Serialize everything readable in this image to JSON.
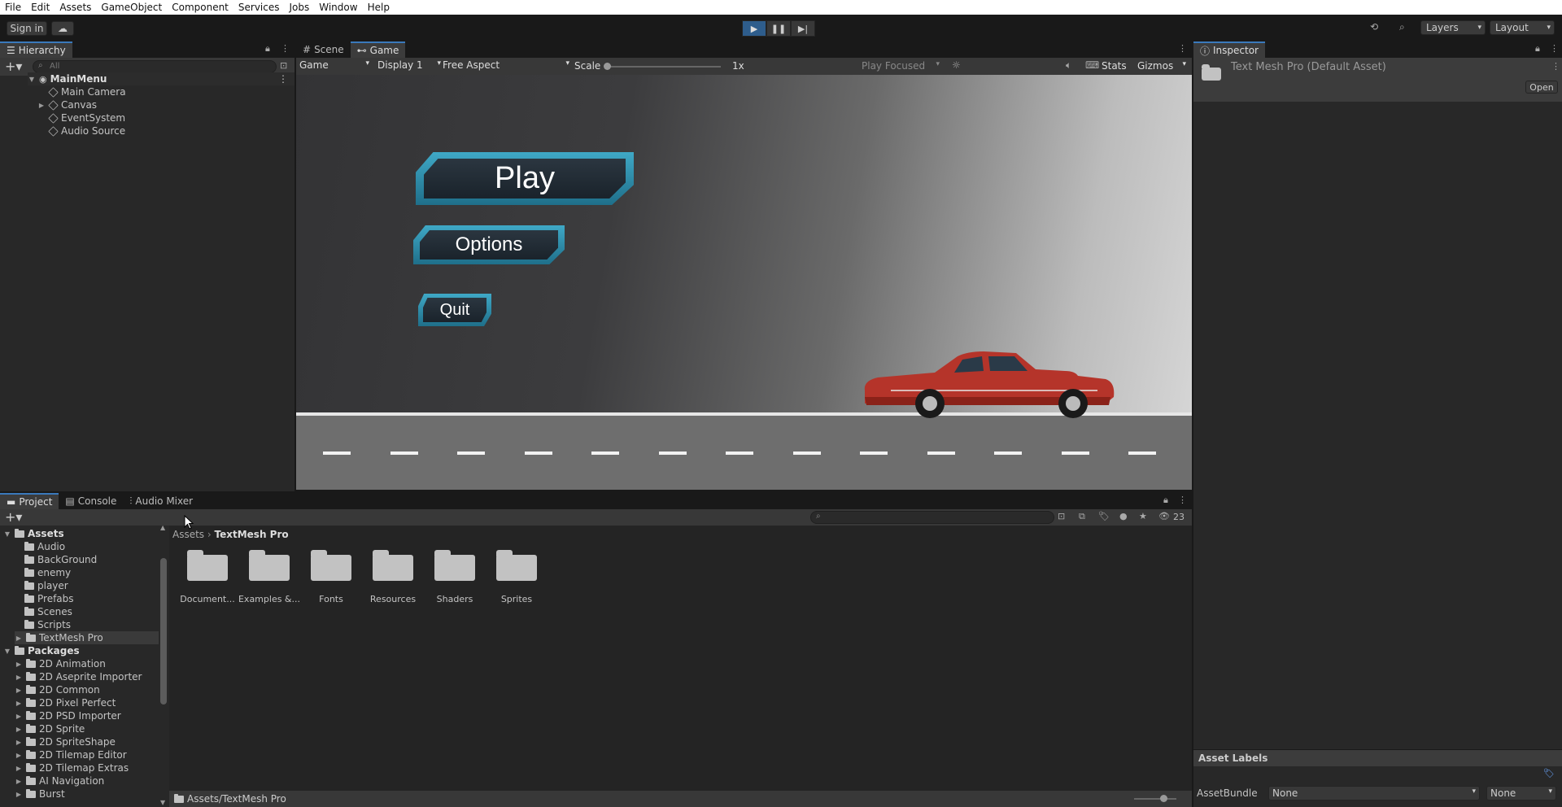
{
  "menubar": [
    "File",
    "Edit",
    "Assets",
    "GameObject",
    "Component",
    "Services",
    "Jobs",
    "Window",
    "Help"
  ],
  "toolbar": {
    "sign_in": "Sign in",
    "layers": "Layers",
    "layout": "Layout"
  },
  "hierarchy": {
    "tab": "Hierarchy",
    "search_placeholder": "All",
    "scene": "MainMenu",
    "items": [
      "Main Camera",
      "Canvas",
      "EventSystem",
      "Audio Source"
    ]
  },
  "scene_tabs": {
    "scene": "Scene",
    "game": "Game"
  },
  "game_toolbar": {
    "mode": "Game",
    "display": "Display 1",
    "aspect": "Free Aspect",
    "scale_label": "Scale",
    "scale_value": "1x",
    "play_focused": "Play Focused",
    "stats": "Stats",
    "gizmos": "Gizmos"
  },
  "game": {
    "play": "Play",
    "options": "Options",
    "quit": "Quit"
  },
  "inspector": {
    "tab": "Inspector",
    "title": "Text Mesh Pro (Default Asset)",
    "open": "Open",
    "asset_labels": "Asset Labels",
    "asset_bundle_label": "AssetBundle",
    "bundle_value": "None",
    "variant_value": "None"
  },
  "project": {
    "tabs": [
      "Project",
      "Console",
      "Audio Mixer"
    ],
    "hidden_count": "23",
    "breadcrumb_root": "Assets",
    "breadcrumb_current": "TextMesh Pro",
    "assets_header": "Assets",
    "assets": [
      "Audio",
      "BackGround",
      "enemy",
      "player",
      "Prefabs",
      "Scenes",
      "Scripts",
      "TextMesh Pro"
    ],
    "packages_header": "Packages",
    "packages": [
      "2D Animation",
      "2D Aseprite Importer",
      "2D Common",
      "2D Pixel Perfect",
      "2D PSD Importer",
      "2D Sprite",
      "2D SpriteShape",
      "2D Tilemap Editor",
      "2D Tilemap Extras",
      "AI Navigation",
      "Burst"
    ],
    "folders": [
      "Document...",
      "Examples &...",
      "Fonts",
      "Resources",
      "Shaders",
      "Sprites"
    ],
    "footer_path": "Assets/TextMesh Pro"
  }
}
